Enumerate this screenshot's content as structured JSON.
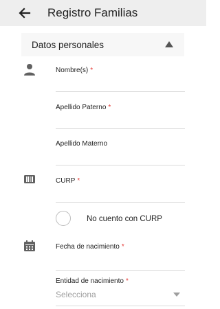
{
  "header": {
    "title": "Registro Familias",
    "back_icon": "arrow-left-icon"
  },
  "section": {
    "title": "Datos personales",
    "toggle_icon": "triangle-up-icon"
  },
  "fields": {
    "nombres": {
      "label": "Nombre(s)",
      "required_mark": "*",
      "value": "",
      "icon": "person-icon"
    },
    "apellido_paterno": {
      "label": "Apellido Paterno",
      "required_mark": "*",
      "value": ""
    },
    "apellido_materno": {
      "label": "Apellido Materno",
      "value": ""
    },
    "curp": {
      "label": "CURP",
      "required_mark": "*",
      "value": "",
      "icon": "barcode-icon"
    },
    "fecha_nacimiento": {
      "label": "Fecha de nacimiento",
      "required_mark": "*",
      "value": "",
      "icon": "calendar-icon"
    },
    "entidad_nacimiento": {
      "label": "Entidad de nacimiento",
      "required_mark": "*",
      "selected": "Selecciona"
    }
  },
  "no_curp": {
    "label": "No cuento con CURP",
    "checked": false
  },
  "colors": {
    "appbar_bg": "#eeeeee",
    "required": "#e53935",
    "icon": "#616161",
    "divider": "#d9d9d9"
  }
}
